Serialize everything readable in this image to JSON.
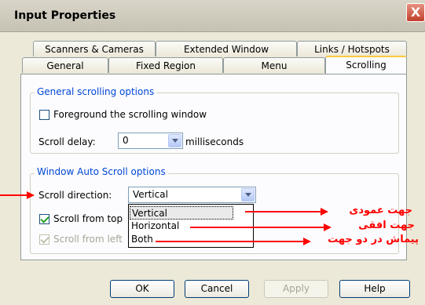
{
  "window": {
    "title": "Input Properties",
    "close_glyph": "X"
  },
  "tabs_row1": [
    {
      "label": "Scanners & Cameras"
    },
    {
      "label": "Extended Window"
    },
    {
      "label": "Links / Hotspots"
    }
  ],
  "tabs_row2": [
    {
      "label": "General"
    },
    {
      "label": "Fixed Region"
    },
    {
      "label": "Menu"
    },
    {
      "label": "Scrolling",
      "active": true
    }
  ],
  "general_group": {
    "title": "General scrolling options",
    "foreground_label": "Foreground the scrolling window",
    "foreground_checked": false,
    "scroll_delay_label": "Scroll delay:",
    "scroll_delay_value": "0",
    "scroll_delay_unit": "milliseconds"
  },
  "auto_group": {
    "title": "Window Auto Scroll options",
    "direction_label": "Scroll direction:",
    "direction_value": "Vertical",
    "options": [
      "Vertical",
      "Horizontal",
      "Both"
    ],
    "scroll_from_top_label": "Scroll from top",
    "scroll_from_top_checked": true,
    "scroll_from_left_label": "Scroll from left",
    "scroll_from_left_checked": true
  },
  "annotations": {
    "vertical": "جهت عمودی",
    "horizontal": "جهت افقی",
    "both": "پیماش در دو جهت",
    "color": "#ff0000"
  },
  "buttons": {
    "ok": "OK",
    "cancel": "Cancel",
    "apply": "Apply",
    "help": "Help"
  }
}
